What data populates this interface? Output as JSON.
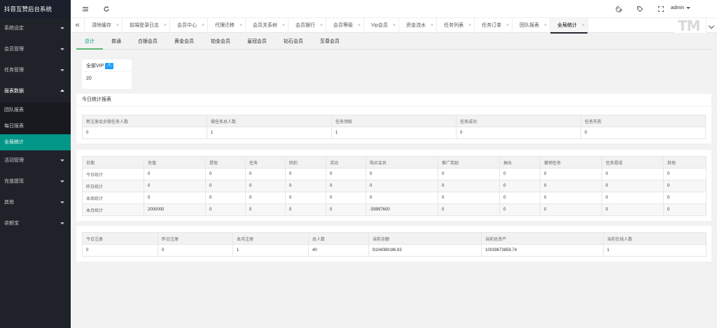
{
  "app": {
    "title": "抖音互赞后台系统"
  },
  "sidebar": {
    "items": [
      {
        "label": "系统设定"
      },
      {
        "label": "会员管理"
      },
      {
        "label": "任务管理"
      },
      {
        "label": "报表数据"
      },
      {
        "label": "活动管理"
      },
      {
        "label": "充值提现"
      },
      {
        "label": "其他"
      },
      {
        "label": "余额宝"
      }
    ],
    "report_sub": [
      {
        "label": "团队报表"
      },
      {
        "label": "每日报表"
      },
      {
        "label": "全局统计"
      }
    ]
  },
  "header": {
    "user": "admin",
    "icons": [
      "menu-fold-icon",
      "refresh-icon",
      "theme-icon",
      "tag-icon",
      "fullscreen-icon"
    ]
  },
  "tabbar": {
    "tabs": [
      {
        "label": "清除缓存"
      },
      {
        "label": "前端登录日志"
      },
      {
        "label": "会员中心"
      },
      {
        "label": "代理迁移"
      },
      {
        "label": "会员关系树"
      },
      {
        "label": "会员银行"
      },
      {
        "label": "会员等级"
      },
      {
        "label": "Vip会员"
      },
      {
        "label": "资金流水"
      },
      {
        "label": "任务列表"
      },
      {
        "label": "任务订单"
      },
      {
        "label": "团队报表"
      },
      {
        "label": "全局统计"
      }
    ],
    "close_glyph": "×",
    "logo_text": "TM"
  },
  "subtabs": [
    "总计",
    "普通",
    "白银会员",
    "黄金会员",
    "铂金会员",
    "皇冠会员",
    "钻石会员",
    "至尊会员"
  ],
  "vip_card": {
    "title": "全部VIP",
    "badge": "人",
    "value": "20"
  },
  "today_panel": {
    "title": "今日统计报表",
    "headers": [
      "新注册会员做任务人数",
      "做任务总人数",
      "任务领取",
      "任务成功",
      "任务失败"
    ],
    "values": [
      "0",
      "1",
      "1",
      "0",
      "0"
    ]
  },
  "stats_table": {
    "headers": [
      "日期",
      "充值",
      "提现",
      "任务",
      "回扣",
      "活动",
      "购买会员",
      "推广奖励",
      "抽水",
      "撤销任务",
      "任务提成",
      "其他"
    ],
    "rows": [
      [
        "今日统计",
        "0",
        "0",
        "0",
        "0",
        "0",
        "0",
        "0",
        "0",
        "0",
        "0",
        "0"
      ],
      [
        "昨日统计",
        "0",
        "0",
        "0",
        "0",
        "0",
        "0",
        "0",
        "0",
        "0",
        "0",
        "0"
      ],
      [
        "本周统计",
        "0",
        "0",
        "0",
        "0",
        "0",
        "0",
        "0",
        "0",
        "0",
        "0",
        "0"
      ],
      [
        "本月统计",
        "2000000",
        "0",
        "0",
        "0",
        "0",
        "-59997600",
        "0",
        "0",
        "0",
        "0",
        "0"
      ]
    ]
  },
  "register_table": {
    "headers": [
      "今日注册",
      "昨日注册",
      "本月注册",
      "总人数",
      "当前余额",
      "当前总资产",
      "当前在线人数"
    ],
    "values": [
      "0",
      "0",
      "1",
      "40",
      "9104089186.83",
      "10039673858.74",
      "1"
    ]
  }
}
